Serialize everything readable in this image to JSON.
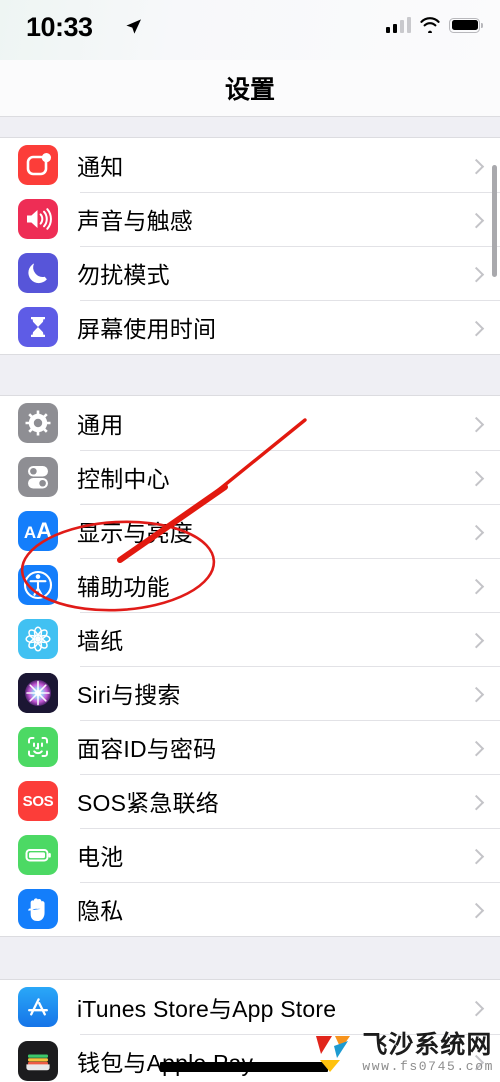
{
  "status_bar": {
    "time": "10:33",
    "location_icon": "location-arrow-icon",
    "cellular_icon": "cellular-signal-icon",
    "cellular_bars_filled": 2,
    "cellular_bars_total": 4,
    "wifi_icon": "wifi-icon",
    "battery_icon": "battery-full-icon",
    "battery_level": 100
  },
  "navbar": {
    "title": "设置"
  },
  "groups": [
    {
      "id": "group-alerts",
      "rows": [
        {
          "label": "通知",
          "icon": "notifications-icon",
          "color": "#FC3D39"
        },
        {
          "label": "声音与触感",
          "icon": "sounds-haptics-icon",
          "color": "#EE2D55"
        },
        {
          "label": "勿扰模式",
          "icon": "do-not-disturb-icon",
          "color": "#5755D9"
        },
        {
          "label": "屏幕使用时间",
          "icon": "screen-time-icon",
          "color": "#5E5CE6"
        }
      ]
    },
    {
      "id": "group-system",
      "rows": [
        {
          "label": "通用",
          "icon": "general-gear-icon",
          "color": "#8E8E93"
        },
        {
          "label": "控制中心",
          "icon": "control-center-icon",
          "color": "#8E8E93"
        },
        {
          "label": "显示与亮度",
          "icon": "display-brightness-icon",
          "color": "#147EFB"
        },
        {
          "label": "辅助功能",
          "icon": "accessibility-icon",
          "color": "#147EFB",
          "highlighted": true
        },
        {
          "label": "墙纸",
          "icon": "wallpaper-icon",
          "color": "#41C1F2"
        },
        {
          "label": "Siri与搜索",
          "icon": "siri-search-icon",
          "color": "#1B1633"
        },
        {
          "label": "面容ID与密码",
          "icon": "face-id-icon",
          "color": "#4CD964"
        },
        {
          "label": "SOS紧急联络",
          "icon": "emergency-sos-icon",
          "color": "#FC3D39"
        },
        {
          "label": "电池",
          "icon": "battery-settings-icon",
          "color": "#4CD964"
        },
        {
          "label": "隐私",
          "icon": "privacy-hand-icon",
          "color": "#147EFB"
        }
      ]
    },
    {
      "id": "group-store",
      "rows": [
        {
          "label": "iTunes Store与App Store",
          "icon": "app-store-icon",
          "color": "#1D9BF6"
        },
        {
          "label": "钱包与Apple Pay",
          "icon": "wallet-icon",
          "color": "#1C1C1E"
        }
      ]
    }
  ],
  "annotations": {
    "ellipse_color": "#E01B18",
    "arrow_color": "#E2190F",
    "target_label": "辅助功能",
    "redaction_bar": true
  },
  "watermark": {
    "name": "飞沙系统网",
    "url": "www.fs0745.com"
  }
}
